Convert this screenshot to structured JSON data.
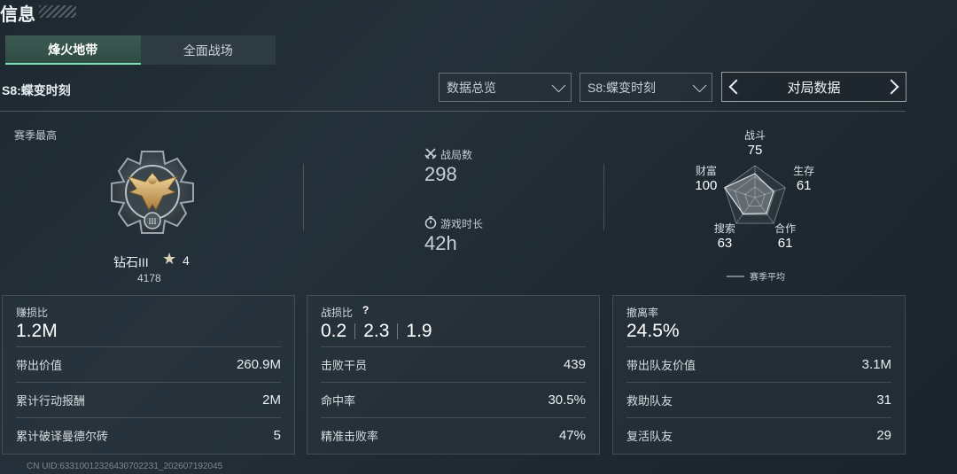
{
  "header": {
    "title": "信息"
  },
  "tabs": [
    {
      "label": "烽火地带"
    },
    {
      "label": "全面战场"
    }
  ],
  "season_label": "S8:蝶变时刻",
  "filters": {
    "dropdown1": "数据总览",
    "dropdown2": "S8:蝶变时刻",
    "nav_label": "对局数据"
  },
  "rank": {
    "title": "赛季最高",
    "tier": "钻石III",
    "stars": "4",
    "score": "4178"
  },
  "matches": {
    "label": "战局数",
    "value": "298"
  },
  "playtime": {
    "label": "游戏时长",
    "value": "42h"
  },
  "chart_data": {
    "type": "radar",
    "axes": [
      {
        "label": "战斗",
        "value": 75
      },
      {
        "label": "生存",
        "value": 61
      },
      {
        "label": "合作",
        "value": 61
      },
      {
        "label": "搜索",
        "value": 63
      },
      {
        "label": "财富",
        "value": 100
      }
    ],
    "max": 100,
    "legend": "赛季平均"
  },
  "panels": [
    {
      "title": "赚损比",
      "value": "1.2M",
      "rows": [
        {
          "label": "带出价值",
          "value": "260.9M"
        },
        {
          "label": "累计行动报酬",
          "value": "2M"
        },
        {
          "label": "累计破译曼德尔砖",
          "value": "5"
        }
      ]
    },
    {
      "title": "战损比",
      "help": "?",
      "values": [
        "0.2",
        "2.3",
        "1.9"
      ],
      "rows": [
        {
          "label": "击败干员",
          "value": "439"
        },
        {
          "label": "命中率",
          "value": "30.5%"
        },
        {
          "label": "精准击败率",
          "value": "47%"
        }
      ]
    },
    {
      "title": "撤离率",
      "value": "24.5%",
      "rows": [
        {
          "label": "带出队友价值",
          "value": "3.1M"
        },
        {
          "label": "救助队友",
          "value": "31"
        },
        {
          "label": "复活队友",
          "value": "29"
        }
      ]
    }
  ],
  "footer": {
    "uid": "CN UID:633100123264307022З1_202607192045"
  }
}
